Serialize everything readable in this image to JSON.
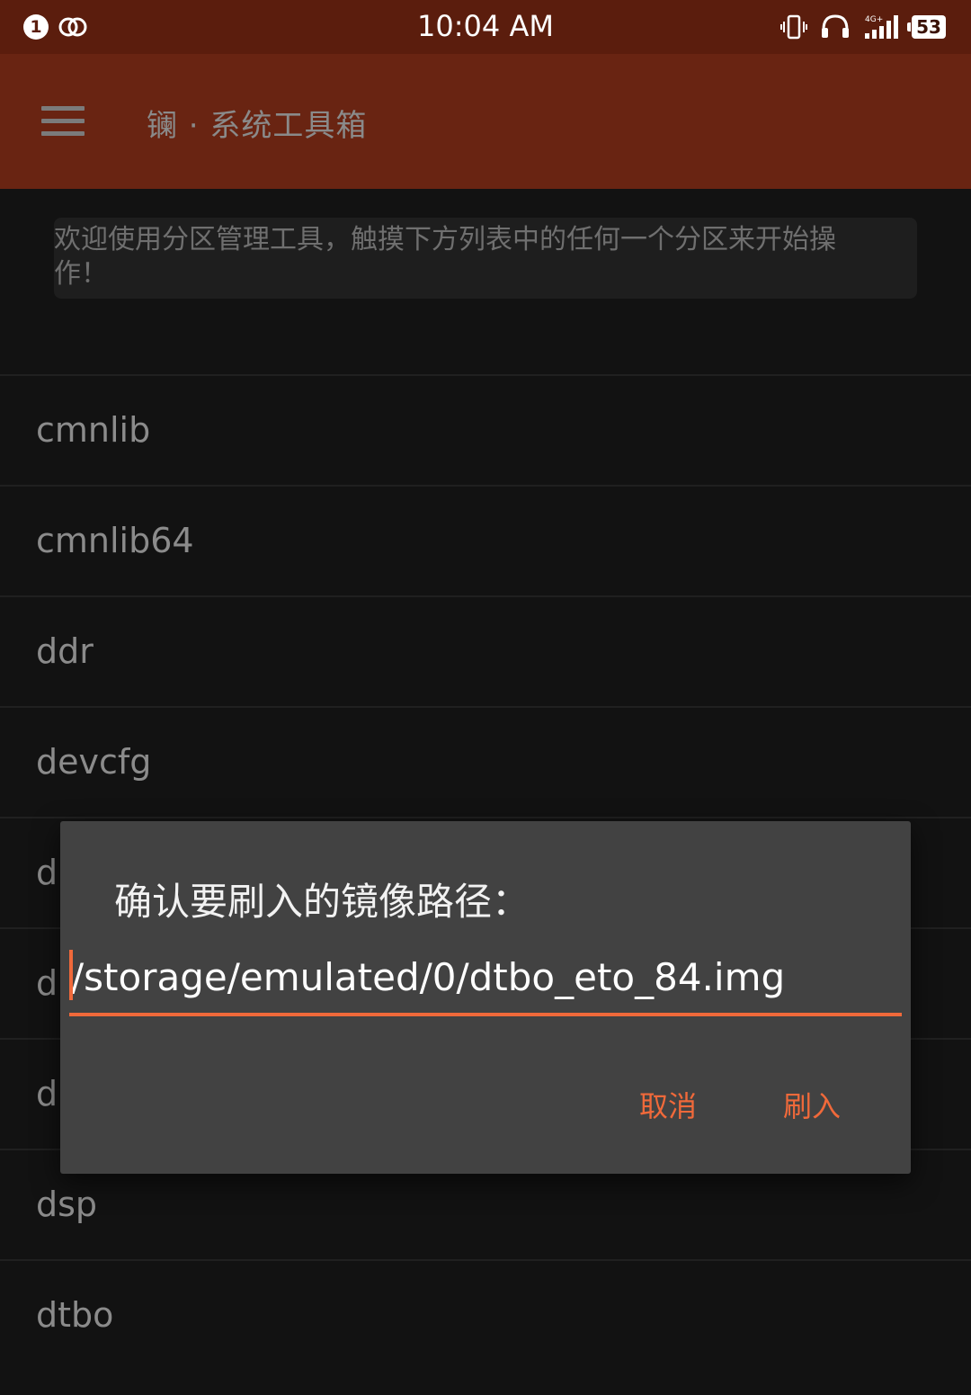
{
  "status_bar": {
    "notification_badge": "1",
    "time": "10:04 AM",
    "network": "4G+",
    "battery": "53"
  },
  "appbar": {
    "title": "镧 · 系统工具箱"
  },
  "info_card": {
    "text": "欢迎使用分区管理工具，触摸下方列表中的任何一个分区来开始操作！"
  },
  "partitions": [
    {
      "name": "cmnlib"
    },
    {
      "name": "cmnlib64"
    },
    {
      "name": "ddr"
    },
    {
      "name": "devcfg"
    },
    {
      "name": "d"
    },
    {
      "name": "d"
    },
    {
      "name": "d"
    },
    {
      "name": "dsp"
    },
    {
      "name": "dtbo"
    }
  ],
  "dialog": {
    "title": "确认要刷入的镜像路径：",
    "path_value": "/storage/emulated/0/dtbo_eto_84.img",
    "cancel_label": "取消",
    "flash_label": "刷入"
  },
  "colors": {
    "status_bar": "#5b1d0d",
    "app_bar": "#692412",
    "accent": "#f0693a",
    "background": "#121212",
    "dialog": "#424242"
  }
}
